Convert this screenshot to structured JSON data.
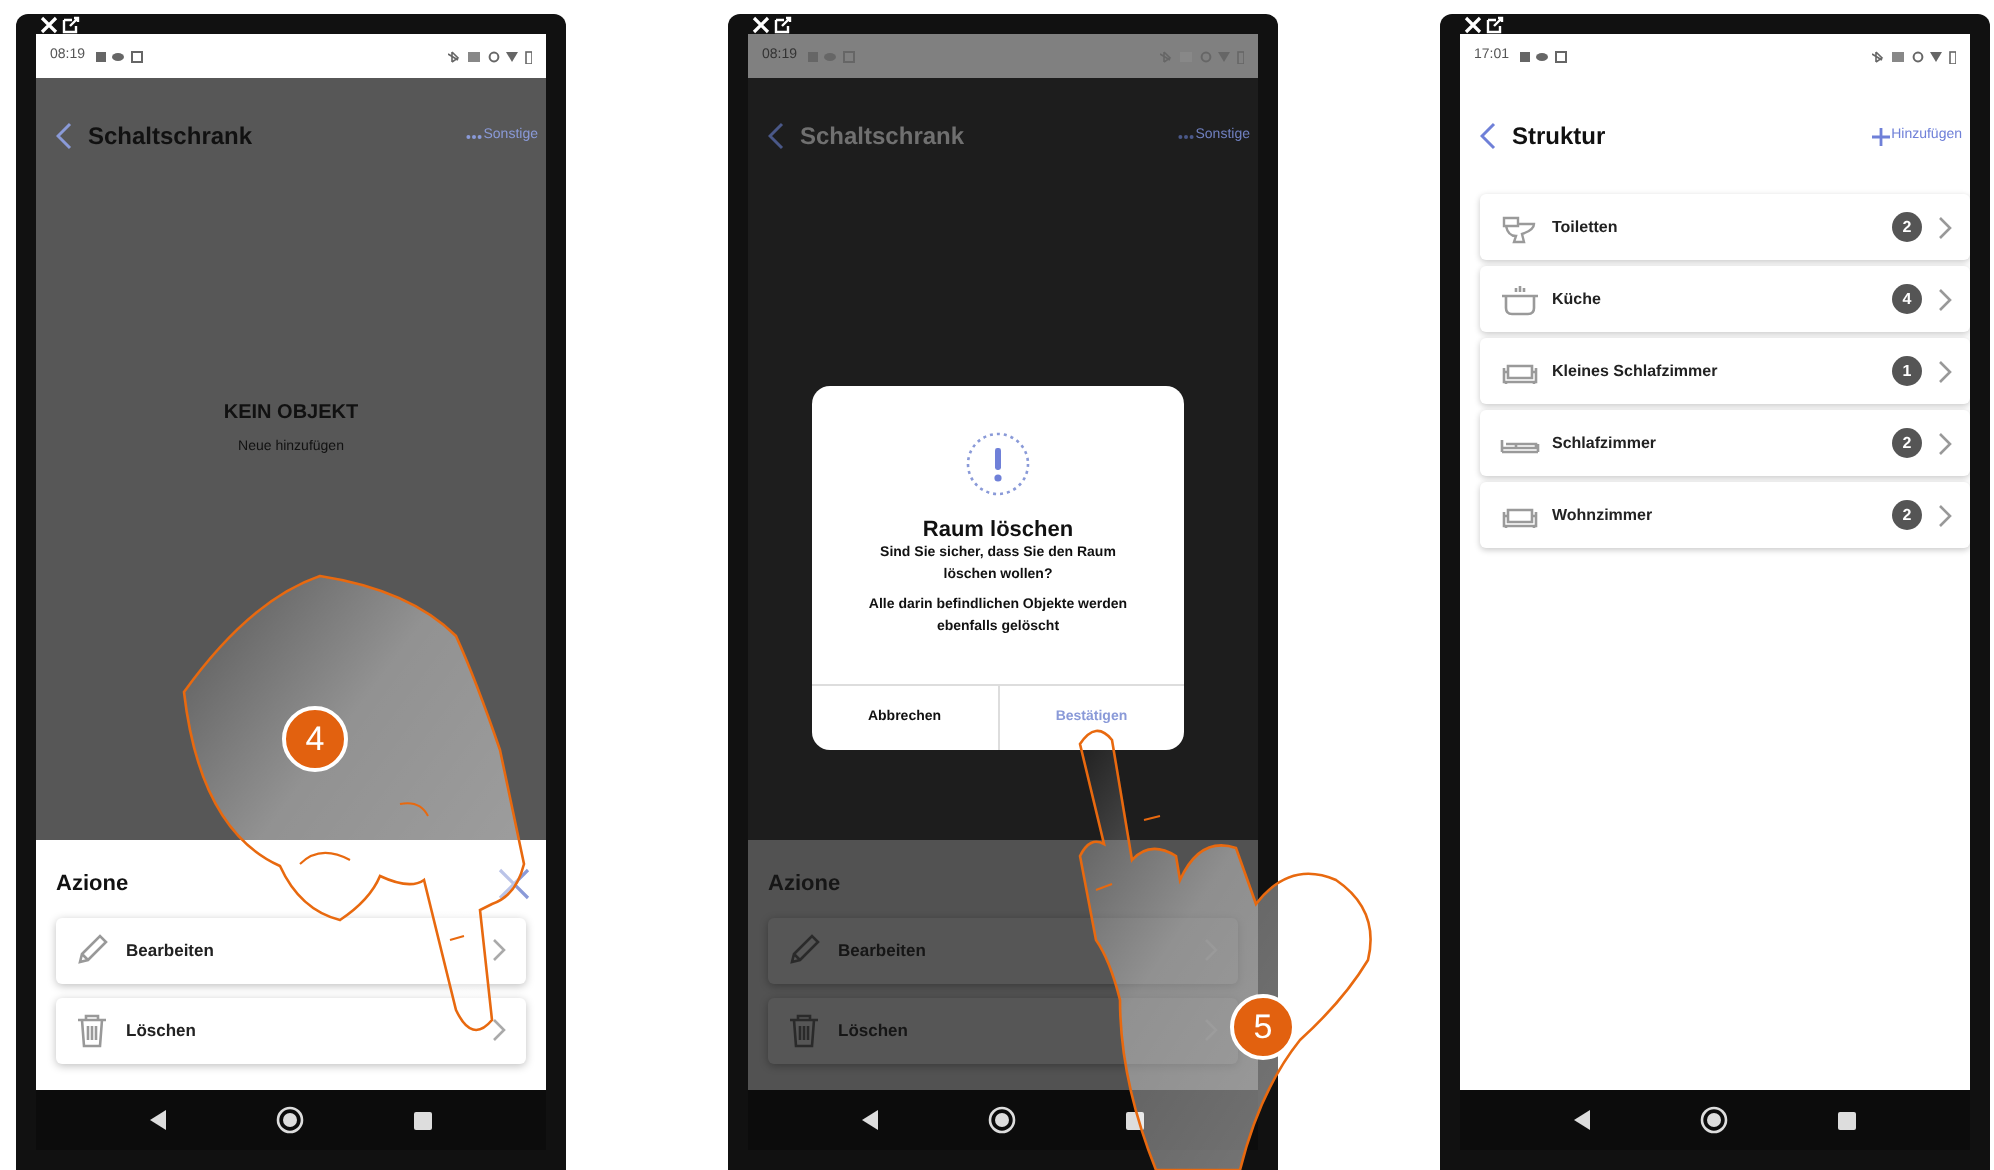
{
  "phones": [
    {
      "kind": "sheet",
      "status_bar": {
        "time": "08:19"
      },
      "header": {
        "title": "Schaltschrank",
        "action": "Sonstige"
      },
      "empty": {
        "title": "KEIN OBJEKT",
        "subtitle": "Neue hinzufügen"
      },
      "sheet": {
        "title": "Azione",
        "items": [
          {
            "label": "Bearbeiten",
            "kind": "pencil"
          },
          {
            "label": "Löschen",
            "kind": "trash"
          }
        ]
      },
      "step": "4"
    },
    {
      "kind": "dialog",
      "status_bar": {
        "time": "08:19"
      },
      "header": {
        "title": "Schaltschrank",
        "action": "Sonstige"
      },
      "sheet": {
        "title": "Azione",
        "items": [
          {
            "label": "Bearbeiten",
            "kind": "pencil"
          },
          {
            "label": "Löschen",
            "kind": "trash"
          }
        ]
      },
      "dialog": {
        "title": "Raum löschen",
        "message": "Sind Sie sicher, dass Sie den Raum löschen wollen?",
        "note": "Alle darin befindlichen Objekte werden ebenfalls gelöscht",
        "buttons": [
          "Abbrechen",
          "Bestätigen"
        ]
      },
      "step": "5"
    },
    {
      "kind": "list",
      "status_bar": {
        "time": "17:01"
      },
      "header": {
        "title": "Struktur",
        "action": "Hinzufügen"
      },
      "rooms": [
        {
          "name": "Toiletten",
          "count": "2",
          "kind": "toilet"
        },
        {
          "name": "Küche",
          "count": "4",
          "kind": "pot"
        },
        {
          "name": "Kleines Schlafzimmer",
          "count": "1",
          "kind": "sofa"
        },
        {
          "name": "Schlafzimmer",
          "count": "2",
          "kind": "bed"
        },
        {
          "name": "Wohnzimmer",
          "count": "2",
          "kind": "sofa"
        }
      ]
    }
  ]
}
